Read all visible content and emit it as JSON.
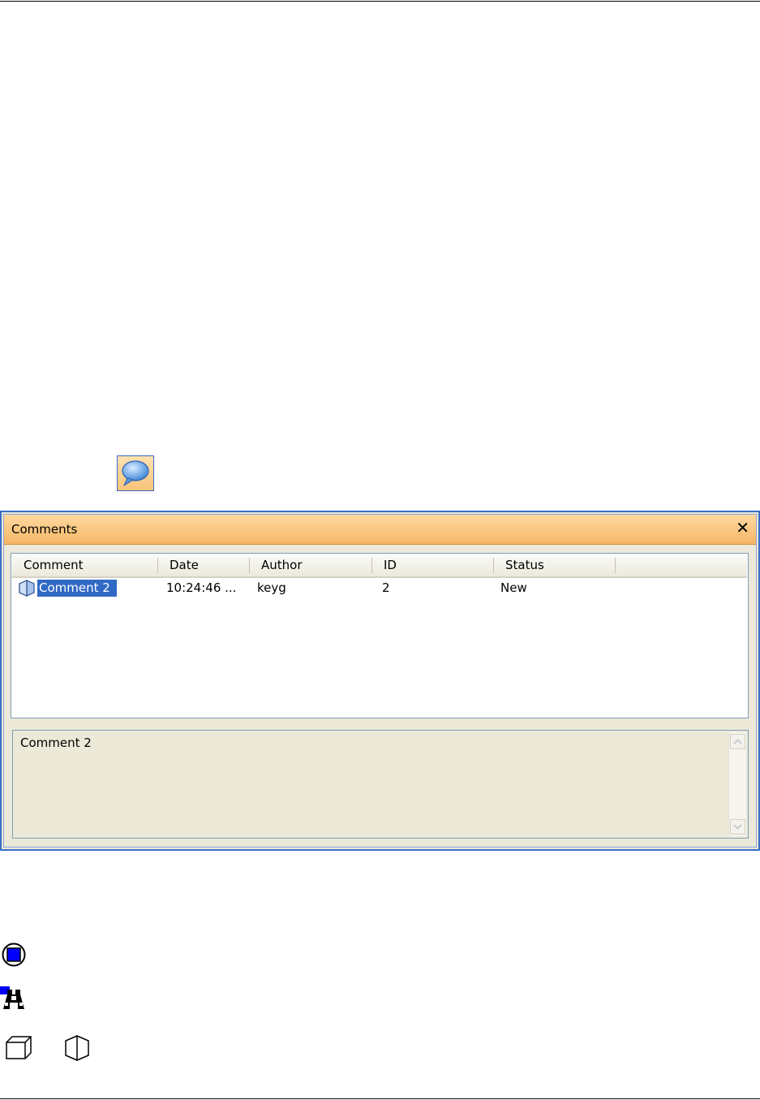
{
  "panel": {
    "title": "Comments",
    "close_label": "✕"
  },
  "table": {
    "columns": [
      "Comment",
      "Date",
      "Author",
      "ID",
      "Status"
    ],
    "rows": [
      {
        "comment": "Comment 2",
        "date": "10:24:46 ...",
        "author": "keyg",
        "id": "2",
        "status": "New"
      }
    ]
  },
  "preview": {
    "text": "Comment 2"
  },
  "icons": {
    "comment_tool": "speech-bubble-icon",
    "row": "half-cube-icon",
    "legend": [
      "circle-square-icon",
      "binoculars-icon",
      "cube-icon",
      "half-cube-icon"
    ]
  },
  "colors": {
    "titlebar": "#f6b766",
    "selection": "#316ac5",
    "frame": "#3b6fc8",
    "legend_blue": "#0000ff"
  }
}
